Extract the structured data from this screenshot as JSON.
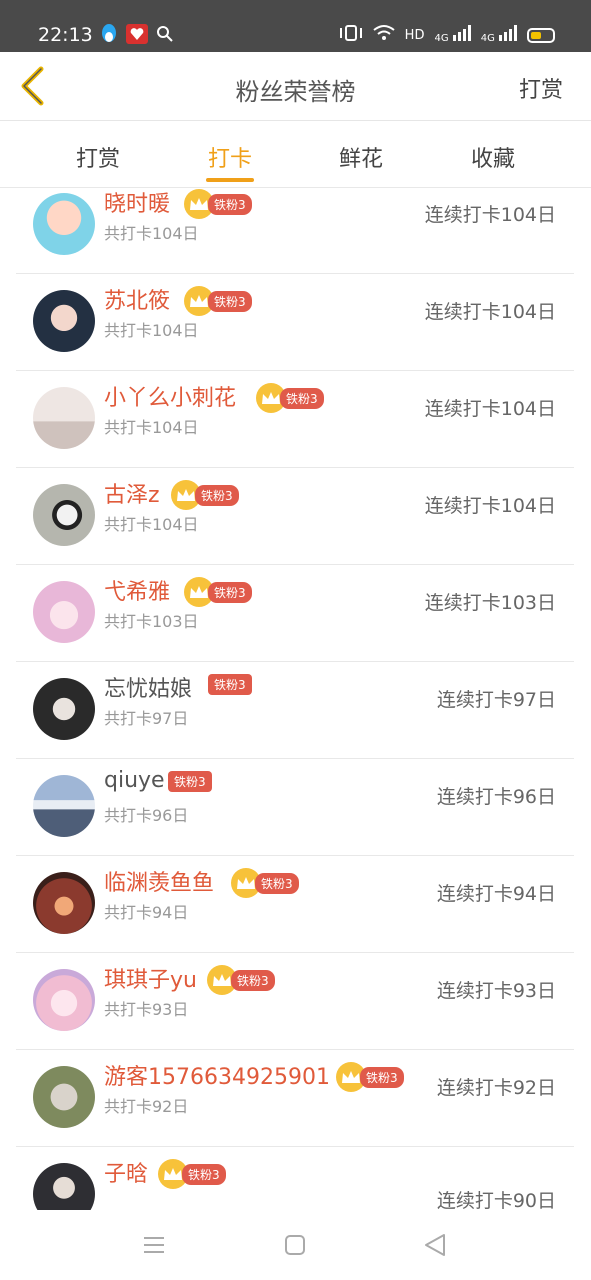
{
  "status": {
    "time": "22:13",
    "hd": "HD",
    "net1": "4G",
    "net2": "4G"
  },
  "header": {
    "title": "粉丝荣誉榜",
    "action": "打赏"
  },
  "tabs": [
    {
      "label": "打赏",
      "active": false
    },
    {
      "label": "打卡",
      "active": true
    },
    {
      "label": "鲜花",
      "active": false
    },
    {
      "label": "收藏",
      "active": false
    }
  ],
  "rows": [
    {
      "name": "晓时暖",
      "badge": "铁粉3",
      "total": "共打卡104日",
      "streak": "连续打卡104日",
      "crown": true,
      "avatar_color": "#7fd3e8"
    },
    {
      "name": "苏北筱",
      "badge": "铁粉3",
      "total": "共打卡104日",
      "streak": "连续打卡104日",
      "crown": true,
      "avatar_color": "#233042"
    },
    {
      "name": "小丫么小刺花",
      "badge": "铁粉3",
      "total": "共打卡104日",
      "streak": "连续打卡104日",
      "crown": true,
      "avatar_color": "#e2d6d3"
    },
    {
      "name": "古泽z",
      "badge": "铁粉3",
      "total": "共打卡104日",
      "streak": "连续打卡104日",
      "crown": true,
      "avatar_color": "#b5b6ae"
    },
    {
      "name": "弋希雅",
      "badge": "铁粉3",
      "total": "共打卡103日",
      "streak": "连续打卡103日",
      "crown": true,
      "avatar_color": "#f2d5ea"
    },
    {
      "name": "忘忧姑娘",
      "badge": "铁粉3",
      "total": "共打卡97日",
      "streak": "连续打卡97日",
      "crown": false,
      "avatar_color": "#3a3a3a"
    },
    {
      "name": "qiuye",
      "badge": "铁粉3",
      "total": "共打卡96日",
      "streak": "连续打卡96日",
      "crown": false,
      "avatar_color": "#8aa3c7"
    },
    {
      "name": "临渊羡鱼鱼",
      "badge": "铁粉3",
      "total": "共打卡94日",
      "streak": "连续打卡94日",
      "crown": true,
      "avatar_color": "#8b3a2e"
    },
    {
      "name": "琪琪子yu",
      "badge": "铁粉3",
      "total": "共打卡93日",
      "streak": "连续打卡93日",
      "crown": true,
      "avatar_color": "#f1bcd2"
    },
    {
      "name": "游客1576634925901",
      "badge": "铁粉3",
      "total": "共打卡92日",
      "streak": "连续打卡92日",
      "crown": true,
      "avatar_color": "#9aa17b"
    },
    {
      "name": "子晗",
      "badge": "铁粉3",
      "total": "",
      "streak": "连续打卡90日",
      "crown": true,
      "avatar_color": "#2e2e33"
    }
  ],
  "colors": {
    "accent": "#f0a019",
    "name_red": "#e05a3a",
    "badge_bg": "#e05a4a",
    "crown": "#f7c23a"
  },
  "icons": {
    "back": "chevron-left-icon",
    "crown": "crown-icon",
    "nav_menu": "menu-icon",
    "nav_home": "home-square-icon",
    "nav_back": "triangle-back-icon"
  }
}
